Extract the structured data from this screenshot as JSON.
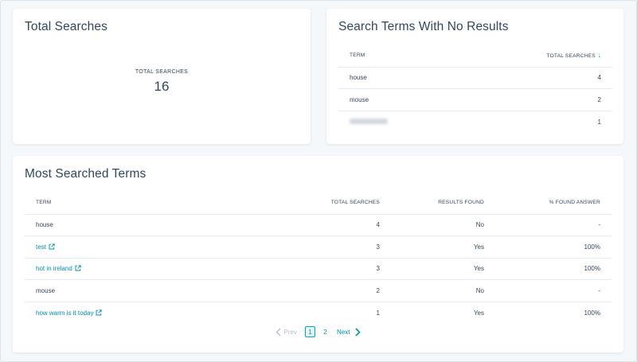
{
  "total_searches_card": {
    "title": "Total Searches",
    "metric_label": "TOTAL SEARCHES",
    "metric_value": "16"
  },
  "no_results_card": {
    "title": "Search Terms With No Results",
    "columns": [
      "TERM",
      "TOTAL SEARCHES"
    ],
    "sort_icon": "arrow-down-icon",
    "rows": [
      {
        "term": "house",
        "total": "4"
      },
      {
        "term": "mouse",
        "total": "2"
      },
      {
        "term": "",
        "total": "1",
        "redacted": true
      }
    ]
  },
  "most_searched_card": {
    "title": "Most Searched Terms",
    "columns": [
      "TERM",
      "TOTAL SEARCHES",
      "RESULTS FOUND",
      "% FOUND ANSWER"
    ],
    "rows": [
      {
        "term": "house",
        "total": "4",
        "results_found": "No",
        "found_answer": "-",
        "link": false
      },
      {
        "term": "test",
        "total": "3",
        "results_found": "Yes",
        "found_answer": "100%",
        "link": true
      },
      {
        "term": "hot in ireland",
        "total": "3",
        "results_found": "Yes",
        "found_answer": "100%",
        "link": true
      },
      {
        "term": "mouse",
        "total": "2",
        "results_found": "No",
        "found_answer": "-",
        "link": false
      },
      {
        "term": "how warm is it today",
        "total": "1",
        "results_found": "Yes",
        "found_answer": "100%",
        "link": true
      }
    ]
  },
  "pagination": {
    "prev_label": "Prev",
    "pages": [
      "1",
      "2"
    ],
    "current_page": "1",
    "next_label": "Next"
  },
  "colors": {
    "link": "#0091ae",
    "text": "#33475b",
    "background": "#f5f8fa",
    "disabled": "#b0c1d4"
  }
}
